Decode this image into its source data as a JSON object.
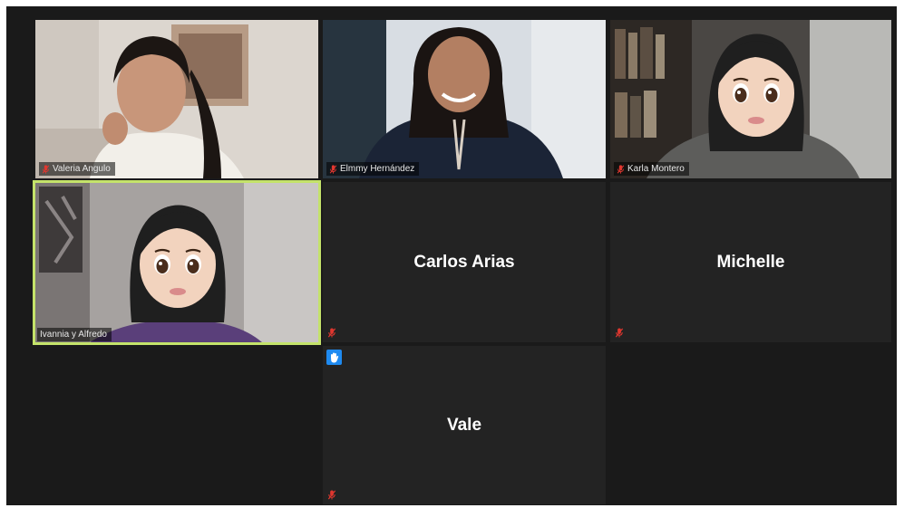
{
  "meeting": {
    "participants": [
      {
        "name": "Valeria Angulo",
        "muted": true,
        "video": true,
        "emoji": false
      },
      {
        "name": "Elmmy Hernández",
        "muted": true,
        "video": true,
        "emoji": false
      },
      {
        "name": "Karla Montero",
        "muted": true,
        "video": true,
        "emoji": true
      },
      {
        "name": "Ivannia y Alfredo",
        "muted": false,
        "video": true,
        "emoji": true,
        "active_speaker": true
      },
      {
        "name": "Carlos Arias",
        "muted": true,
        "video": false
      },
      {
        "name": "Michelle",
        "muted": true,
        "video": false
      },
      {
        "name": "Vale",
        "muted": true,
        "video": false,
        "hand_raised": true
      }
    ]
  },
  "colors": {
    "active_speaker_border": "#c4e36a",
    "mute_icon": "#e0372f",
    "raise_hand_badge": "#1e8af0",
    "tile_background": "#232323",
    "grid_background": "#1a1a1a"
  },
  "icons": {
    "mute": "microphone-muted-icon",
    "raise_hand": "raised-hand-icon"
  }
}
